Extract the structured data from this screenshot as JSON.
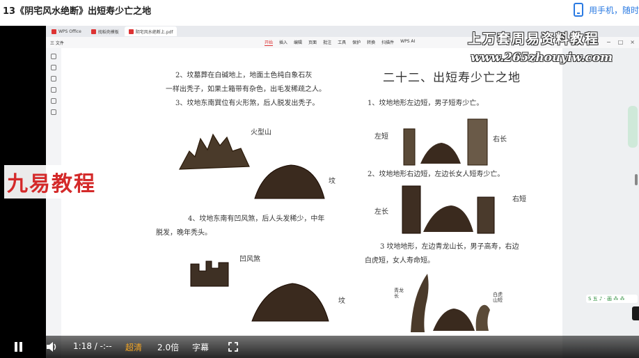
{
  "page": {
    "title": "13《阴宅风水绝断》出短寿少亡之地",
    "phone_link": "用手机，随时"
  },
  "wps": {
    "tabs": [
      "WPS Office",
      "找稻壳模板",
      "阴宅风水绝断上.pdf"
    ],
    "menu_left": [
      "三 文件"
    ],
    "menu_center": [
      "开始",
      "插入",
      "编辑",
      "页面",
      "批注",
      "工具",
      "保护",
      "转换",
      "扫描件",
      "WPS AI"
    ],
    "active_menu": "开始"
  },
  "document": {
    "left_lines": [
      "2、坟墓葬在白碱地上，地面土色纯白象石灰",
      "一样出秃子，如果土箱带有杂色，出毛发稀疏之人。",
      "3、坟地东南巽位有火形煞，后人脱发出秃子。"
    ],
    "label_fire_mountain": "火型山",
    "label_tomb_1": "坟",
    "left_lines_2": [
      "4、坟地东南有凹风煞，后人头发稀少，中年",
      "脱发，晚年秃头。"
    ],
    "label_concave_wind": "凹风煞",
    "label_tomb_2": "坟",
    "heading": "二十二、出短寿少亡之地",
    "right_line_1": "1、坟地地形左边短，男子短寿少亡。",
    "label_left_short": "左短",
    "label_right_long": "右长",
    "right_line_2": "2、坟地地形右边短，左边长女人短寿少亡。",
    "label_left_long": "左长",
    "label_right_short": "右短",
    "right_lines_3": [
      "3 坟地地形，左边青龙山长，男子高寿，右边",
      "白虎短，女人寿命短。"
    ],
    "label_qinglong": "青龙长",
    "label_baihu": "白虎山短"
  },
  "watermarks": {
    "line1": "上万套周易资料教程",
    "line2": "www.265zhouyiw.com",
    "brand": "九易教程"
  },
  "player": {
    "time": "1:18 / -:--",
    "quality": "超清",
    "speed": "2.0倍",
    "subtitle": "字幕"
  },
  "colors": {
    "accent_blue": "#2a7ae2",
    "brand_red": "#d42a2a",
    "quality_orange": "#f5a623"
  },
  "icons": [
    "phone-icon",
    "pause-icon",
    "volume-icon",
    "fullscreen-icon"
  ]
}
